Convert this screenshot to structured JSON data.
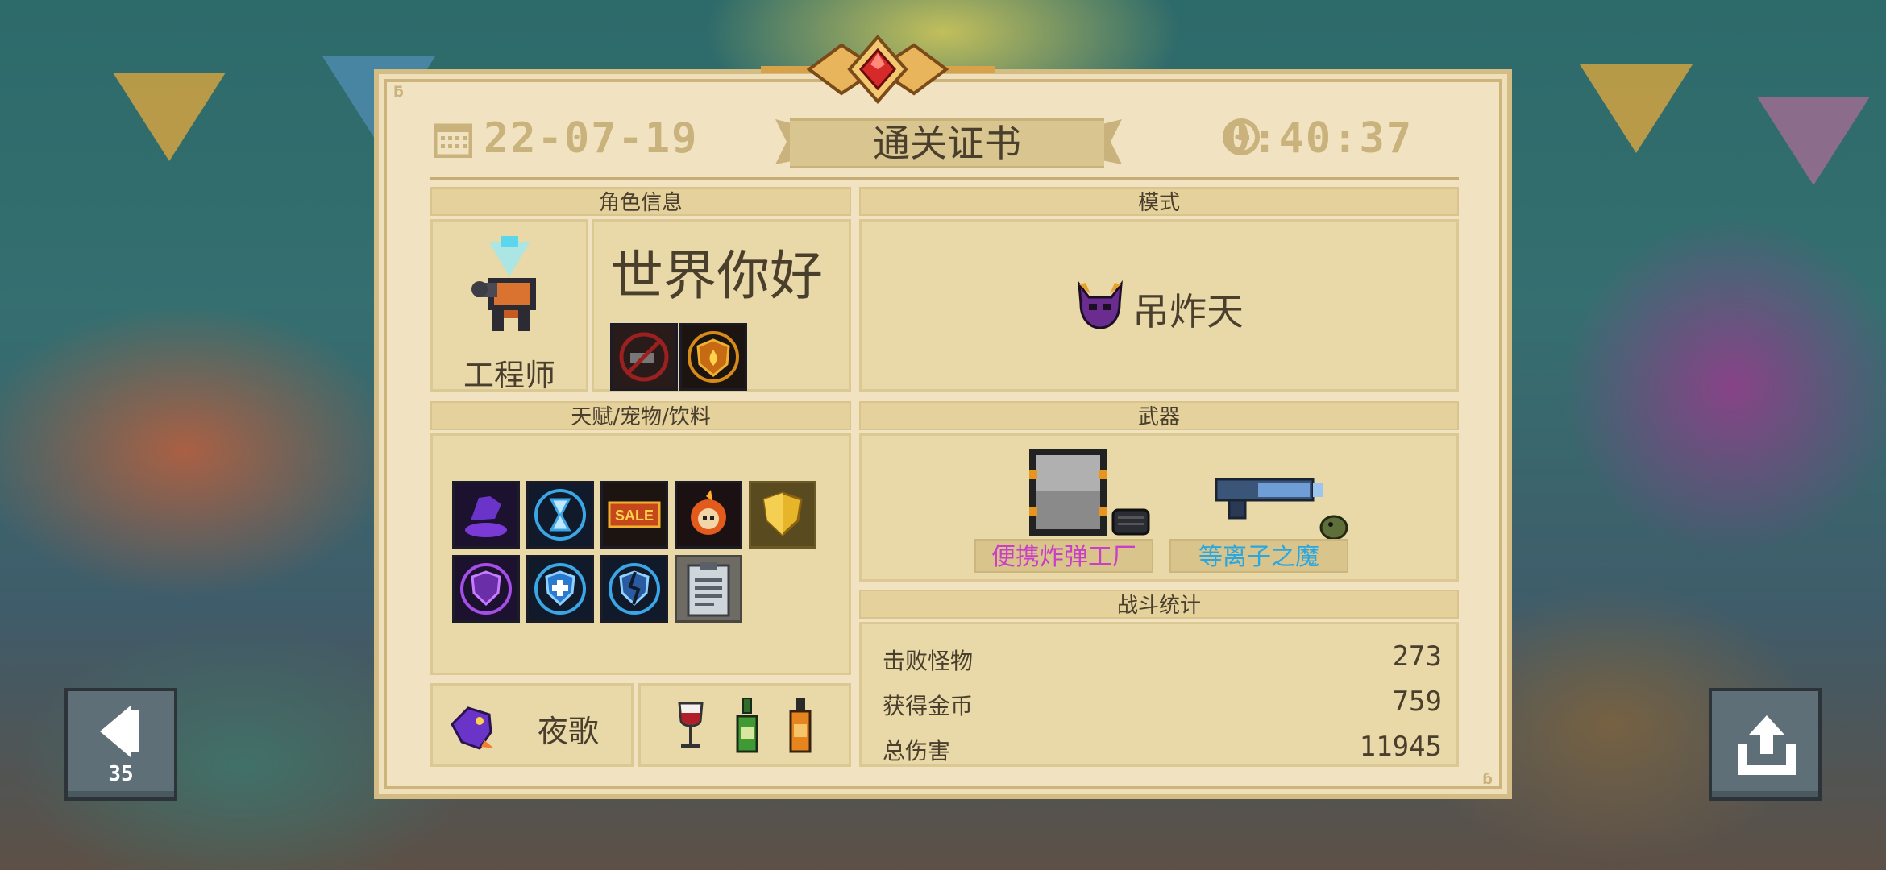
{
  "certificate": {
    "date": "22-07-19",
    "title": "通关证书",
    "time": "0:40:37"
  },
  "sections": {
    "character": "角色信息",
    "mode": "模式",
    "talents": "天赋/宠物/饮料",
    "weapons": "武器",
    "combat_stats": "战斗统计"
  },
  "character": {
    "class_name": "工程师",
    "player_name": "世界你好",
    "skill_icons": [
      "no-turret-skill-icon",
      "fire-shield-skill-icon"
    ]
  },
  "mode": {
    "name": "吊炸天",
    "icon": "purple-demon-helmet-icon"
  },
  "talents": {
    "icons": [
      "purple-hand-portal-icon",
      "hourglass-icon",
      "sale-sign-icon",
      "fire-skull-icon",
      "gold-shield-icon",
      "purple-shield-icon",
      "blue-cross-shield-icon",
      "broken-blue-shield-icon",
      "clipboard-icon"
    ]
  },
  "pet": {
    "name": "夜歌",
    "icon": "purple-bird-pet-icon"
  },
  "drinks": {
    "icons": [
      "red-wine-glass-icon",
      "green-bottle-icon",
      "orange-bottle-icon"
    ]
  },
  "weapons": [
    {
      "name": "便携炸弹工厂",
      "color": "#c93fc8",
      "icon": "bomb-factory-icon"
    },
    {
      "name": "等离子之魔",
      "color": "#2aa6e0",
      "icon": "plasma-gun-icon"
    }
  ],
  "stats": [
    {
      "label": "击败怪物",
      "value": "273"
    },
    {
      "label": "获得金币",
      "value": "759"
    },
    {
      "label": "总伤害",
      "value": "11945"
    }
  ],
  "buttons": {
    "back_countdown": "35",
    "back_icon": "back-arrow-icon",
    "share_icon": "share-upload-icon"
  },
  "colors": {
    "paper": "#f1e3c1",
    "header_gold": "#c9b27c",
    "text_brown": "#4a3f2c"
  }
}
